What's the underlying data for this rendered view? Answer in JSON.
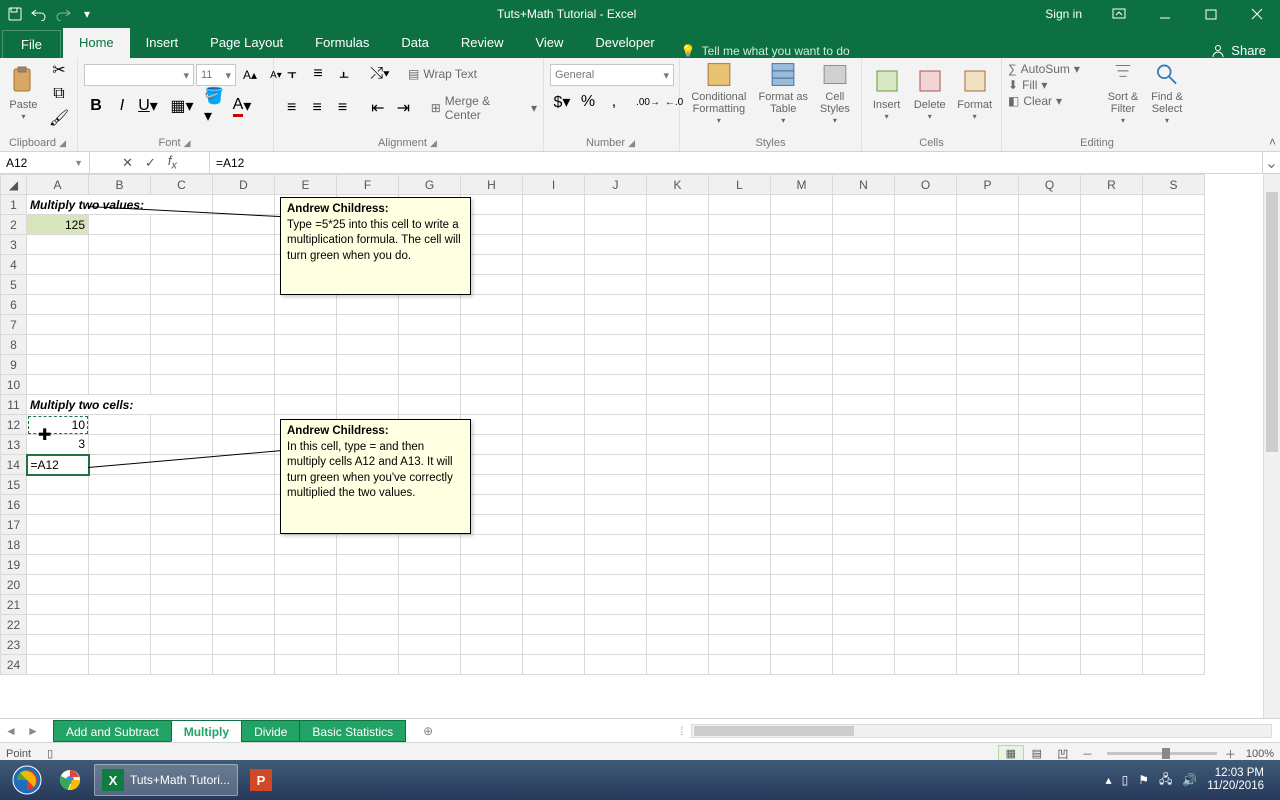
{
  "titlebar": {
    "title": "Tuts+Math Tutorial  -  Excel",
    "signin": "Sign in"
  },
  "tabs": {
    "file": "File",
    "home": "Home",
    "insert": "Insert",
    "pagelayout": "Page Layout",
    "formulas": "Formulas",
    "data": "Data",
    "review": "Review",
    "view": "View",
    "developer": "Developer",
    "tellme": "Tell me what you want to do",
    "share": "Share"
  },
  "groups": {
    "clipboard": "Clipboard",
    "paste": "Paste",
    "font": "Font",
    "alignment": "Alignment",
    "number": "Number",
    "styles": "Styles",
    "cells": "Cells",
    "editing": "Editing",
    "wraptext": "Wrap Text",
    "merge": "Merge & Center",
    "numberformat": "General",
    "conditional": "Conditional Formatting",
    "formatas": "Format as Table",
    "cellstyles": "Cell Styles",
    "insert": "Insert",
    "delete": "Delete",
    "format": "Format",
    "autosum": "AutoSum",
    "fill": "Fill",
    "clear": "Clear",
    "sort": "Sort & Filter",
    "find": "Find & Select",
    "fontsize": "11"
  },
  "fx": {
    "namebox": "A12",
    "formula": "=A12"
  },
  "cols": [
    "A",
    "B",
    "C",
    "D",
    "E",
    "F",
    "G",
    "H",
    "I",
    "J",
    "K",
    "L",
    "M",
    "N",
    "O",
    "P",
    "Q",
    "R",
    "S"
  ],
  "rows": 24,
  "cells": {
    "r1": "Multiply two values:",
    "a2": "125",
    "r11": "Multiply two cells:",
    "a12": "10",
    "a13": "3",
    "a14": "=A12"
  },
  "comments": {
    "c1": {
      "author": "Andrew Childress:",
      "text": "Type =5*25 into this cell to write a multiplication formula. The cell will turn green when you do."
    },
    "c2": {
      "author": "Andrew Childress:",
      "text": "In this cell, type = and then multiply cells A12 and A13. It will turn green when you've correctly multiplied the two values."
    }
  },
  "sheets": {
    "s1": "Add and Subtract",
    "s2": "Multiply",
    "s3": "Divide",
    "s4": "Basic Statistics"
  },
  "status": {
    "mode": "Point",
    "zoom": "100%"
  },
  "taskbar": {
    "app": "Tuts+Math Tutori...",
    "time": "12:03 PM",
    "date": "11/20/2016"
  }
}
